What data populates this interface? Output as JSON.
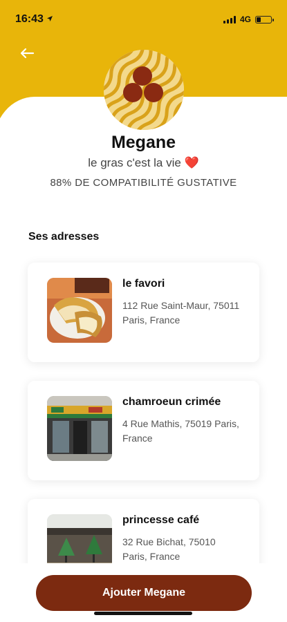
{
  "status_bar": {
    "time": "16:43",
    "network": "4G",
    "battery_level": 0.3,
    "icons": [
      "location-arrow-icon",
      "signal-icon",
      "battery-icon"
    ]
  },
  "header": {
    "back_icon": "arrow-left-icon",
    "background_color": "#e8b50a"
  },
  "profile": {
    "name": "Megane",
    "bio": "le gras c'est la vie ❤️",
    "compatibility": "88% DE COMPATIBILITÉ GUSTATIVE",
    "avatar_icon": "noodles-avatar-icon"
  },
  "addresses_section": {
    "title": "Ses adresses",
    "items": [
      {
        "name": "le favori",
        "address": "112 Rue Saint-Maur, 75011 Paris, France",
        "thumb": "sandwich-photo"
      },
      {
        "name": "chamroeun crimée",
        "address": "4 Rue Mathis, 75019 Paris, France",
        "thumb": "storefront-photo"
      },
      {
        "name": "princesse café",
        "address": "32 Rue Bichat, 75010 Paris, France",
        "thumb": "cafe-terrace-photo"
      }
    ]
  },
  "cta": {
    "label": "Ajouter Megane",
    "color": "#7c2a10"
  }
}
